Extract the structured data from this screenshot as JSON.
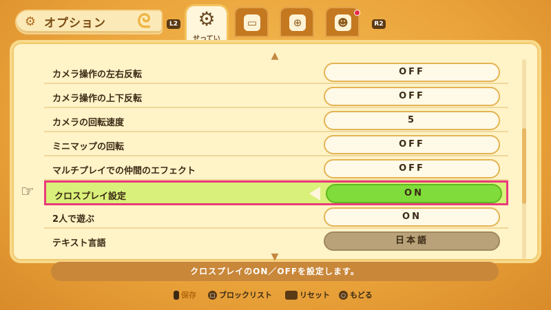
{
  "header": {
    "title": "オプション",
    "left_hint": "L2",
    "right_hint": "R2",
    "tabs": [
      {
        "icon": "gear-icon",
        "label": "せってい",
        "active": true
      },
      {
        "icon": "monitor-icon",
        "label": "",
        "active": false
      },
      {
        "icon": "gamepad-icon",
        "label": "",
        "active": false
      },
      {
        "icon": "character-icon",
        "label": "",
        "active": false
      }
    ]
  },
  "settings": [
    {
      "label": "カメラ操作の左右反転",
      "value": "OFF",
      "state": "normal"
    },
    {
      "label": "カメラ操作の上下反転",
      "value": "OFF",
      "state": "normal"
    },
    {
      "label": "カメラの回転速度",
      "value": "5",
      "state": "normal"
    },
    {
      "label": "ミニマップの回転",
      "value": "OFF",
      "state": "normal"
    },
    {
      "label": "マルチプレイでの仲間のエフェクト",
      "value": "OFF",
      "state": "normal"
    },
    {
      "label": "クロスプレイ設定",
      "value": "ON",
      "state": "selected"
    },
    {
      "label": "2人で遊ぶ",
      "value": "ON",
      "state": "normal"
    },
    {
      "label": "テキスト言語",
      "value": "日本語",
      "state": "disabled"
    }
  ],
  "description": "クロスプレイのON／OFFを設定します。",
  "footer": {
    "save": "保存",
    "blocklist": "ブロックリスト",
    "reset": "リセット",
    "back": "もどる"
  },
  "colors": {
    "selected_row": "#d9f07a",
    "selected_border": "#ea3a7a",
    "selected_value": "#7fdc3a",
    "panel": "#fff3c8",
    "frame": "#e8a83a"
  }
}
